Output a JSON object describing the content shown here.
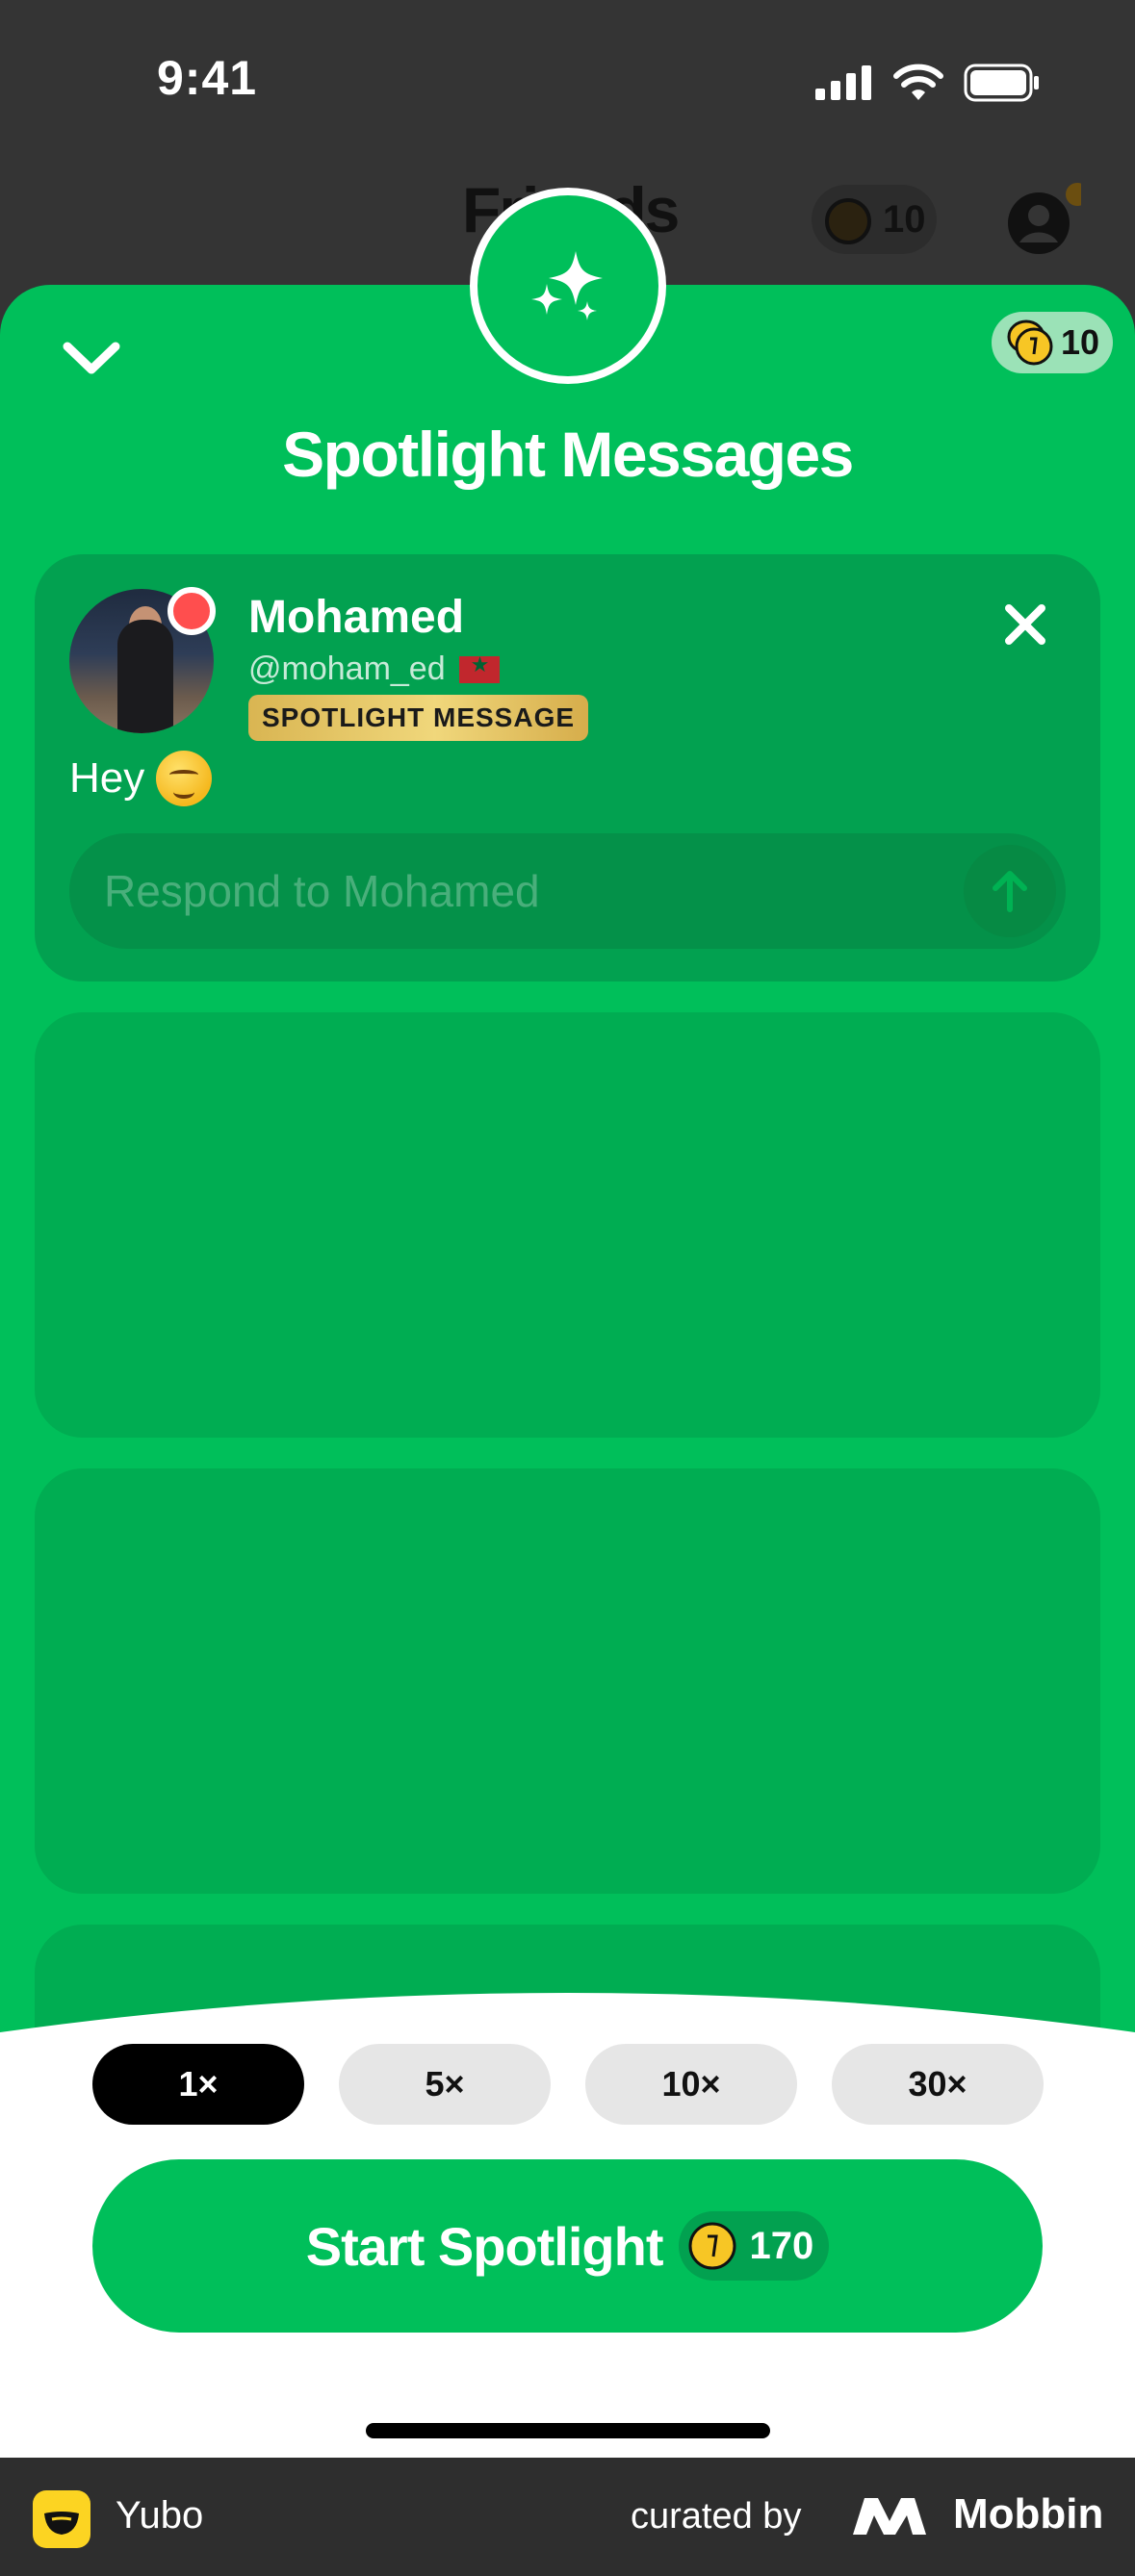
{
  "status_bar": {
    "time": "9:41"
  },
  "background_header": {
    "title": "Friends",
    "coins": "10"
  },
  "sheet": {
    "title": "Spotlight Messages",
    "coin_balance": "10"
  },
  "message_card": {
    "name": "Mohamed",
    "handle": "@moham_ed",
    "badge": "SPOTLIGHT MESSAGE",
    "message": "Hey",
    "reply_placeholder": "Respond to Mohamed"
  },
  "multipliers": [
    {
      "label": "1×",
      "selected": true
    },
    {
      "label": "5×",
      "selected": false
    },
    {
      "label": "10×",
      "selected": false
    },
    {
      "label": "30×",
      "selected": false
    }
  ],
  "start_button": {
    "label": "Start Spotlight",
    "price": "170"
  },
  "footer": {
    "app_name": "Yubo",
    "curated_by": "curated by",
    "brand": "Mobbin"
  },
  "colors": {
    "accent_green": "#00bf5a",
    "gold": "#f0d77b",
    "live_red": "#ff4e4e"
  }
}
